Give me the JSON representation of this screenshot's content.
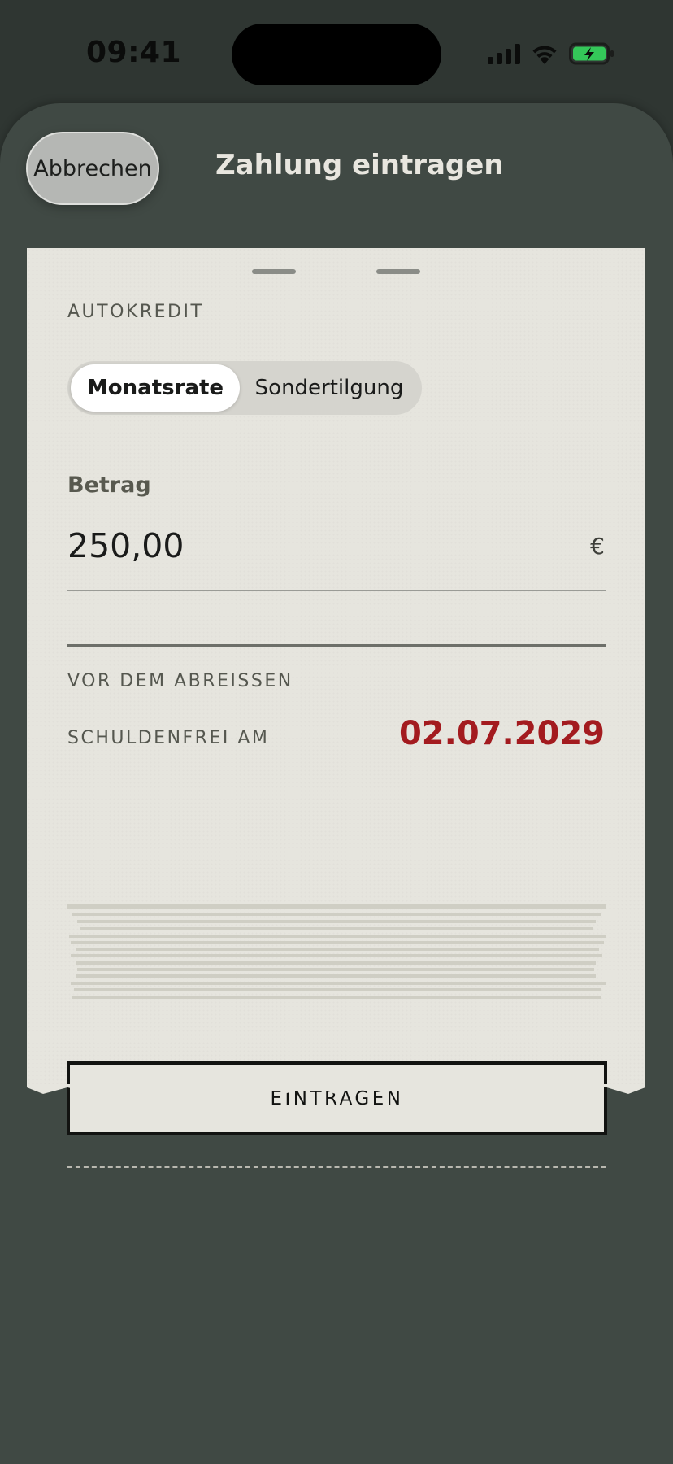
{
  "status_bar": {
    "time": "09:41",
    "colors": {
      "battery": "#34c759"
    }
  },
  "sheet": {
    "cancel_label": "Abbrechen",
    "title": "Zahlung eintragen"
  },
  "receipt": {
    "account": "AUTOKREDIT",
    "payment_types": [
      {
        "label": "Monatsrate",
        "selected": true
      },
      {
        "label": "Sondertilgung",
        "selected": false
      }
    ],
    "amount": {
      "label": "Betrag",
      "value": "250,00",
      "currency": "€"
    },
    "tear_hint": "VOR DEM ABREISSEN",
    "debt_free": {
      "label": "SCHULDENFREI AM",
      "date": "02.07.2029",
      "color": "#a31b1f"
    },
    "submit_label": "EINTRAGEN"
  }
}
